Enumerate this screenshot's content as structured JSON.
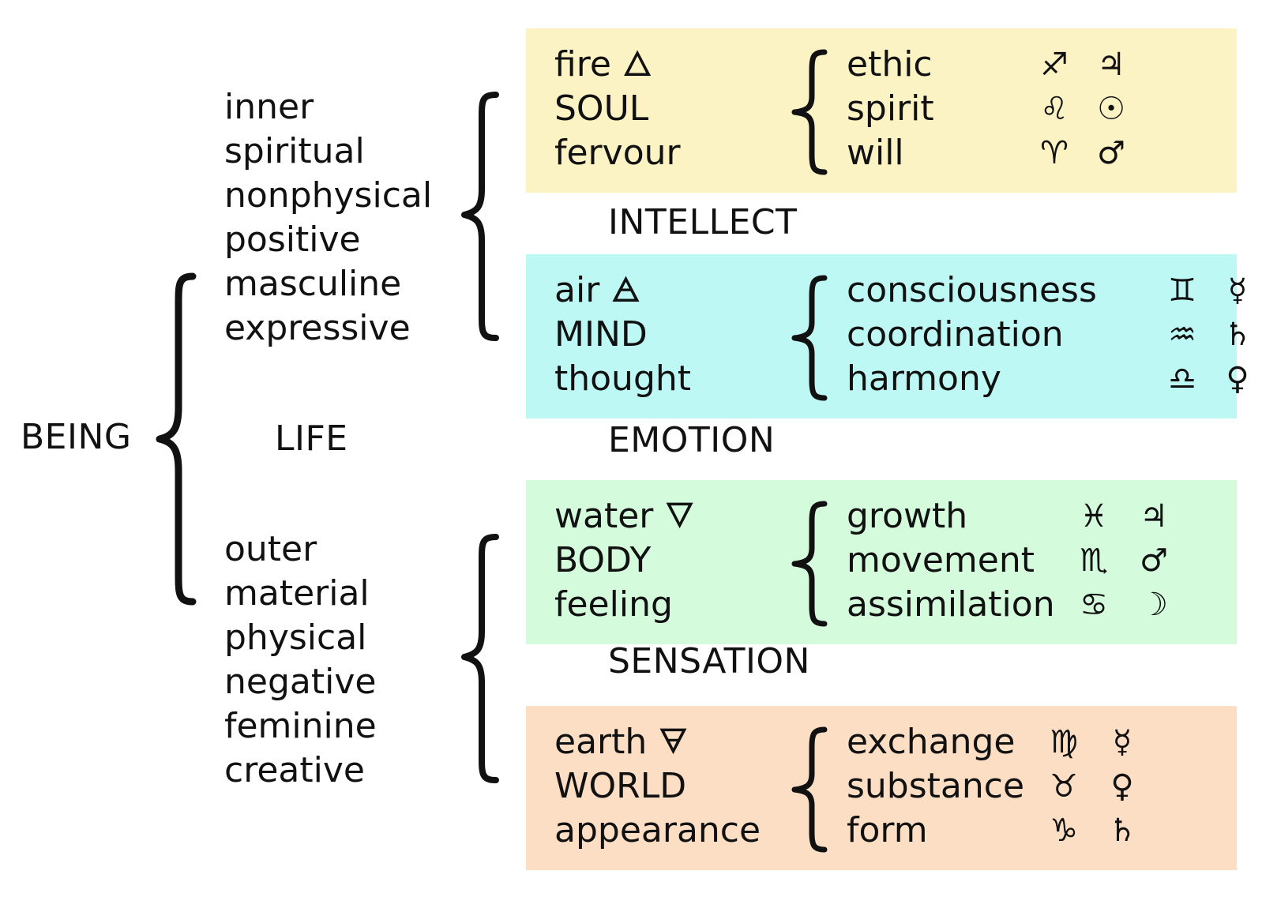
{
  "root": "BEING",
  "life": "LIFE",
  "inner_terms": [
    "inner",
    "spiritual",
    "nonphysical",
    "positive",
    "masculine",
    "expressive"
  ],
  "outer_terms": [
    "outer",
    "material",
    "physical",
    "negative",
    "feminine",
    "creative"
  ],
  "headings": {
    "intellect": "INTELLECT",
    "emotion": "EMOTION",
    "sensation": "SENSATION"
  },
  "panels": {
    "fire": {
      "color": "#fcf3c5",
      "lines": [
        "fire",
        "SOUL",
        "fervour"
      ],
      "element_symbol": "🜂",
      "items": [
        {
          "word": "ethic",
          "sign": "♐",
          "planet": "♃"
        },
        {
          "word": "spirit",
          "sign": "♌",
          "planet": "☉"
        },
        {
          "word": "will",
          "sign": "♈",
          "planet": "♂"
        }
      ]
    },
    "air": {
      "color": "#bdf8f4",
      "lines": [
        "air",
        "MIND",
        "thought"
      ],
      "element_symbol": "🜁",
      "items": [
        {
          "word": "consciousness",
          "sign": "♊",
          "planet": "☿"
        },
        {
          "word": "coordination",
          "sign": "♒",
          "planet": "♄"
        },
        {
          "word": "harmony",
          "sign": "♎",
          "planet": "♀"
        }
      ]
    },
    "water": {
      "color": "#d4fbdc",
      "lines": [
        "water",
        "BODY",
        "feeling"
      ],
      "element_symbol": "🜄",
      "items": [
        {
          "word": "growth",
          "sign": "♓",
          "planet": "♃"
        },
        {
          "word": "movement",
          "sign": "♏",
          "planet": "♂"
        },
        {
          "word": "assimilation",
          "sign": "♋",
          "planet": "☽"
        }
      ]
    },
    "earth": {
      "color": "#fcdec4",
      "lines": [
        "earth",
        "WORLD",
        "appearance"
      ],
      "element_symbol": "🜃",
      "items": [
        {
          "word": "exchange",
          "sign": "♍",
          "planet": "☿"
        },
        {
          "word": "substance",
          "sign": "♉",
          "planet": "♀"
        },
        {
          "word": "form",
          "sign": "♑",
          "planet": "♄"
        }
      ]
    }
  }
}
